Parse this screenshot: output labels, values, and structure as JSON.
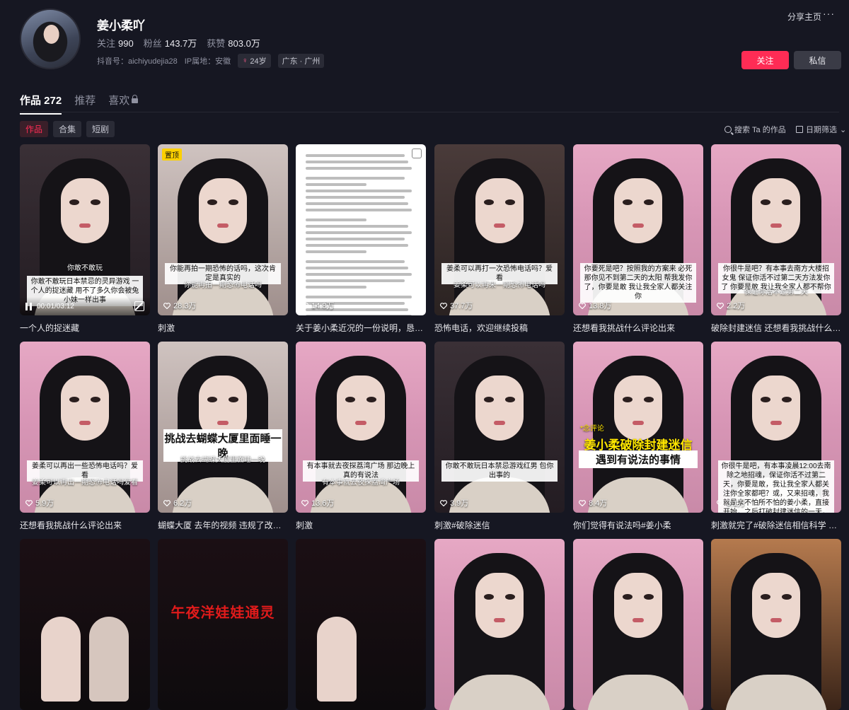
{
  "profile": {
    "name": "姜小柔吖",
    "stats": [
      {
        "label": "关注",
        "value": "990"
      },
      {
        "label": "粉丝",
        "value": "143.7万"
      },
      {
        "label": "获赞",
        "value": "803.0万"
      }
    ],
    "douyin_id": "抖音号：aichiyudejia28",
    "ip": "IP属地：安徽",
    "age": "24岁",
    "location": "广东 · 广州",
    "share_label": "分享主页",
    "more_label": "···",
    "follow_label": "关注",
    "message_label": "私信"
  },
  "tabs": [
    {
      "label": "作品 272",
      "active": true
    },
    {
      "label": "推荐",
      "active": false
    },
    {
      "label": "喜欢",
      "active": false
    }
  ],
  "subtabs": [
    {
      "label": "作品",
      "active": true
    },
    {
      "label": "合集",
      "active": false
    },
    {
      "label": "短剧",
      "active": false
    }
  ],
  "toolbar": {
    "search_label": "搜索 Ta 的作品",
    "date_filter_label": "日期筛选"
  },
  "videos": [
    {
      "title": "一个人的捉迷藏",
      "likes": "",
      "cap1": "你敢不敢玩日本禁忌的灵异游戏 一个人的捉迷藏 用不了多久你会被兔小妹一样出事",
      "cap2": "你敢不敢玩",
      "playing": true,
      "time": "00:01/03:12"
    },
    {
      "title": "刺激",
      "likes": "28.3万",
      "cap1": "你能再拍一期恐怖的话吗，这次肯定是真实的",
      "cap2": "你能再拍一期恐怖电话吗",
      "pinned": "置顶"
    },
    {
      "title": "关于姜小柔近况的一份说明，恳请大…",
      "likes": "14.8万",
      "doc": true
    },
    {
      "title": "恐怖电话，欢迎继续投稿",
      "likes": "37.7万",
      "cap1": "姜柔可以再打一次恐怖电话吗？爱看",
      "cap2": "姜柔可以再来一期恐怖电话吗"
    },
    {
      "title": "还想看我挑战什么评论出来",
      "likes": "13.8万",
      "cap1": "你要死是吧？按照我的方案来 必死 那你见不到第二天的太阳 帮我发你了，你要是敢 我让我全家人都关注你",
      "cap2": ""
    },
    {
      "title": "破除封建迷信 还想看我挑战什么评…",
      "likes": "2.2万",
      "cap1": "你很牛是吧？有本事去南方大楼招女鬼 保证你活不过第二天方法发你了 你要是敢 我让我全家人都不帮你",
      "cap2": "保证你活不过第二天"
    },
    {
      "title": "还想看我挑战什么评论出来",
      "likes": "5.9万",
      "cap1": "姜柔可以再出一些恐怖电话吗？爱看",
      "cap2": "姜柔可以再出一期恐怖电话吗爱看"
    },
    {
      "title": "蝴蝶大厦 去年的视频 违规了改了一…",
      "likes": "6.2万",
      "big": "挑战去蝴蝶大厦里面睡一晚",
      "cap2": "挑战去蝴蝶大厦里面睡一晚"
    },
    {
      "title": "刺激",
      "likes": "13.6万",
      "cap1": "有本事就去夜探荔湾广场 那边晚上真的有说法",
      "cap2": "有本事就去夜探荔湾广场"
    },
    {
      "title": "刺激#破除迷信",
      "likes": "3.9万",
      "cap1": "你敢不敢玩日本禁忌游戏红男 包你出事的",
      "cap2": ""
    },
    {
      "title": "你们觉得有说法吗#姜小柔",
      "likes": "8.4万",
      "yellow": "姜小柔破除封建迷信",
      "cap1": "遇到有说法的事情",
      "comment": "*念评论"
    },
    {
      "title": "刺激就完了#破除迷信相信科学 #姜…",
      "likes": "3.1万",
      "cap1": "你很牛是吧，有本事凌晨12:00去南除之地招魂，保证你活不过第二天，你要是敢，我让我全家人都关注你全家都吧？或，又来招魂，我就是来不怕所不怕的姜小柔，直接开始，之后打破封建迷信的一天，于了家人们",
      "cap2": ""
    },
    {
      "title": "",
      "likes": "",
      "night": true
    },
    {
      "title": "",
      "likes": "",
      "red": "午夜洋娃娃通灵"
    },
    {
      "title": "",
      "likes": "",
      "night2": true
    },
    {
      "title": "",
      "likes": ""
    },
    {
      "title": "",
      "likes": ""
    },
    {
      "title": "",
      "likes": ""
    }
  ]
}
